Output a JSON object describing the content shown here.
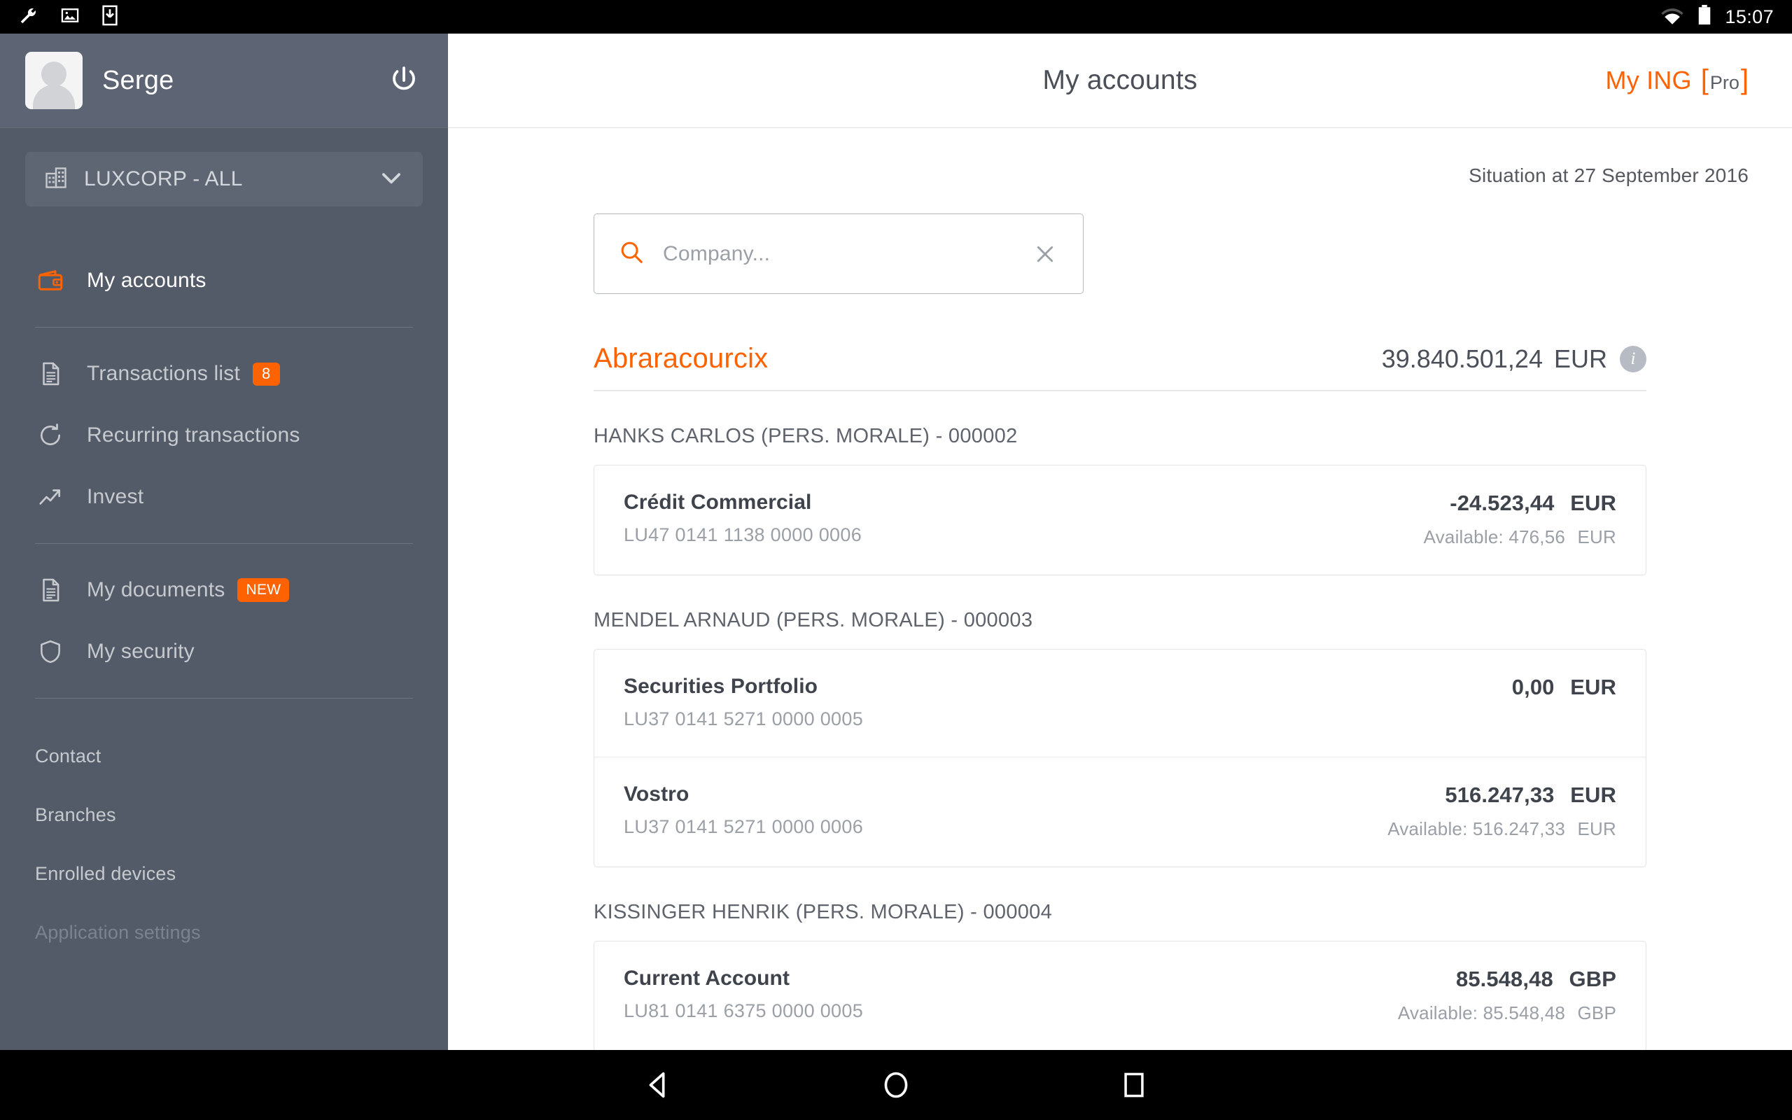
{
  "status_bar": {
    "icons": [
      "wrench-icon",
      "image-icon",
      "download-icon"
    ],
    "wifi": "wifi-icon",
    "battery": "battery-icon",
    "time": "15:07"
  },
  "sidebar": {
    "user_name": "Serge",
    "power_label": "power-icon",
    "company_selector": {
      "value": "LUXCORP - ALL",
      "icon": "building-icon",
      "chevron": "chevron-down-icon"
    },
    "nav_items": [
      {
        "label": "My accounts",
        "icon": "wallet-icon",
        "active": true,
        "badge": ""
      },
      {
        "label": "Transactions list",
        "icon": "document-icon",
        "active": false,
        "badge": "8"
      },
      {
        "label": "Recurring transactions",
        "icon": "refresh-icon",
        "active": false,
        "badge": ""
      },
      {
        "label": "Invest",
        "icon": "trend-up-icon",
        "active": false,
        "badge": ""
      },
      {
        "label": "My documents",
        "icon": "document-icon",
        "active": false,
        "badge": "NEW"
      },
      {
        "label": "My security",
        "icon": "shield-icon",
        "active": false,
        "badge": ""
      }
    ],
    "footer_links": [
      {
        "label": "Contact",
        "dim": false
      },
      {
        "label": "Branches",
        "dim": false
      },
      {
        "label": "Enrolled devices",
        "dim": false
      },
      {
        "label": "Application settings",
        "dim": true
      }
    ]
  },
  "header": {
    "title": "My accounts",
    "brand_my": "My ING",
    "brand_pro": "Pro",
    "bracket_left": "[",
    "bracket_right": "]"
  },
  "main": {
    "situation": "Situation at 27 September 2016",
    "search": {
      "placeholder": "Company...",
      "value": "",
      "icon": "search-icon",
      "clear_icon": "close-icon"
    },
    "company": {
      "name": "Abraracourcix",
      "total_amount": "39.840.501,24",
      "total_currency": "EUR",
      "info_icon": "info-icon"
    },
    "groups": [
      {
        "title": "HANKS CARLOS (PERS. MORALE) - 000002",
        "accounts": [
          {
            "name": "Crédit Commercial",
            "iban": "LU47 0141 1138 0000 0006",
            "amount": "-24.523,44",
            "currency": "EUR",
            "available": "Available: 476,56",
            "available_currency": "EUR"
          }
        ]
      },
      {
        "title": "MENDEL ARNAUD (PERS. MORALE) - 000003",
        "accounts": [
          {
            "name": "Securities Portfolio",
            "iban": "LU37 0141 5271 0000 0005",
            "amount": "0,00",
            "currency": "EUR",
            "available": "",
            "available_currency": ""
          },
          {
            "name": "Vostro",
            "iban": "LU37 0141 5271 0000 0006",
            "amount": "516.247,33",
            "currency": "EUR",
            "available": "Available: 516.247,33",
            "available_currency": "EUR"
          }
        ]
      },
      {
        "title": "KISSINGER HENRIK (PERS. MORALE) - 000004",
        "accounts": [
          {
            "name": "Current Account",
            "iban": "LU81 0141 6375 0000 0005",
            "amount": "85.548,48",
            "currency": "GBP",
            "available": "Available: 85.548,48",
            "available_currency": "GBP"
          }
        ]
      }
    ]
  },
  "navbar": {
    "back": "back-icon",
    "home": "home-icon",
    "recents": "recents-icon"
  },
  "colors": {
    "accent": "#ff6200",
    "sidebar_bg": "#545b68",
    "text_dark": "#3f444c",
    "text_muted": "#9ba0a7"
  }
}
